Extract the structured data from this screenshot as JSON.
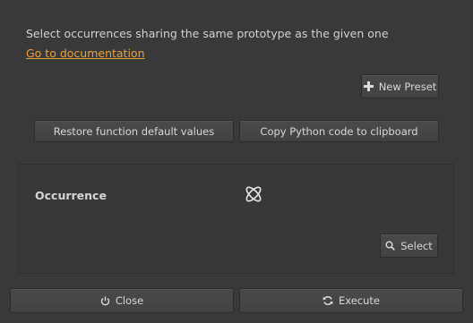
{
  "description": "Select occurrences sharing the same prototype as the given one",
  "doc_link": "Go to documentation",
  "toolbar": {
    "new_preset_label": "New Preset"
  },
  "actions": {
    "restore_label": "Restore function default values",
    "copy_label": "Copy Python code to clipboard"
  },
  "param": {
    "label": "Occurrence",
    "icon": "occurrence-icon",
    "select_label": "Select"
  },
  "footer": {
    "close_label": "Close",
    "execute_label": "Execute"
  },
  "colors": {
    "background": "#393939",
    "link": "#e8a33d",
    "text": "#d2d2d2"
  }
}
